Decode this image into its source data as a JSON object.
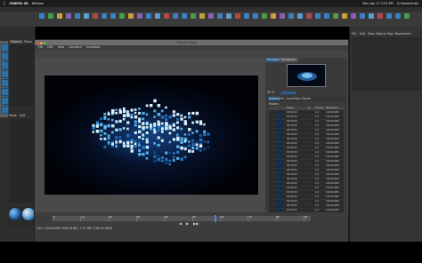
{
  "menubar": {
    "apple": "",
    "app_name": "CINEMA 4D",
    "items": [
      "Window"
    ],
    "right": "Mon Apr 17 1:53 PM",
    "user": "EJ Hassenfratz"
  },
  "picture_viewer": {
    "title": "Picture Viewer",
    "menu": [
      "File",
      "Edit",
      "View",
      "Compare",
      "Animation"
    ],
    "side_tabs": [
      "Navigator",
      "Histogram"
    ],
    "zoom": "50 %",
    "side_subtabs": [
      "History",
      "Info",
      "Layer",
      "Filter",
      "Stereo"
    ],
    "history_label": "History",
    "history_columns": [
      "Name",
      "R",
      "Frames",
      "Resolution"
    ],
    "history_rows": [
      {
        "name": "00:00:00",
        "r": "",
        "frames": "1/1",
        "res": "1920x1080"
      },
      {
        "name": "00:00:00",
        "r": "",
        "frames": "1/1",
        "res": "1920x1080"
      },
      {
        "name": "00:00:00",
        "r": "",
        "frames": "1/1",
        "res": "1920x1080"
      },
      {
        "name": "00:00:00",
        "r": "",
        "frames": "1/1",
        "res": "1920x1080"
      },
      {
        "name": "00:00:00",
        "r": "",
        "frames": "1/1",
        "res": "1920x1080"
      },
      {
        "name": "00:00:00",
        "r": "",
        "frames": "1/1",
        "res": "1920x1080"
      },
      {
        "name": "00:00:00",
        "r": "",
        "frames": "1/1",
        "res": "1920x1080"
      },
      {
        "name": "00:00:00",
        "r": "",
        "frames": "1/1",
        "res": "1920x1080"
      },
      {
        "name": "00:00:00",
        "r": "",
        "frames": "1/1",
        "res": "1920x1080"
      },
      {
        "name": "00:00:00",
        "r": "",
        "frames": "1/1",
        "res": "1920x1080"
      },
      {
        "name": "00:00:00",
        "r": "",
        "frames": "1/1",
        "res": "1920x1080"
      },
      {
        "name": "00:00:00",
        "r": "",
        "frames": "1/1",
        "res": "1920x1080"
      },
      {
        "name": "00:00:00",
        "r": "",
        "frames": "1/1",
        "res": "1920x1080"
      },
      {
        "name": "00:00:00",
        "r": "",
        "frames": "1/1",
        "res": "1920x1080"
      },
      {
        "name": "00:00:00",
        "r": "",
        "frames": "1/1",
        "res": "1920x1080"
      },
      {
        "name": "00:00:00",
        "r": "",
        "frames": "1/1",
        "res": "1920x1080"
      },
      {
        "name": "00:00:00",
        "r": "",
        "frames": "1/1",
        "res": "1920x1080"
      },
      {
        "name": "00:00:00",
        "r": "",
        "frames": "1/1",
        "res": "1920x1080"
      },
      {
        "name": "00:00:00",
        "r": "",
        "frames": "1/1",
        "res": "1920x1080"
      },
      {
        "name": "00:00:00",
        "r": "",
        "frames": "1/1",
        "res": "1920x1080"
      },
      {
        "name": "00:00:00",
        "r": "",
        "frames": "1/1",
        "res": "1920x1080"
      },
      {
        "name": "00:00:00",
        "r": "",
        "frames": "1/1",
        "res": "1920x1080"
      },
      {
        "name": "00:00:00",
        "r": "",
        "frames": "1/1",
        "res": "1920x1080"
      },
      {
        "name": "00:00:00",
        "r": "",
        "frames": "1/1",
        "res": "1920x1080"
      },
      {
        "name": "00:00:00",
        "r": "",
        "frames": "1/1",
        "res": "1920x1080"
      },
      {
        "name": "00:00:00",
        "r": "",
        "frames": "1/1",
        "res": "1920x1080"
      }
    ],
    "timeline_labels": [
      "0",
      "10",
      "20",
      "30",
      "40",
      "50",
      "60",
      "70",
      "80",
      "90"
    ],
    "playhead_frame": 58,
    "timeline_max": 90,
    "status": "Size: 1920x1080, RGB (8 Bit), 7.97 MB, 3.98 (in RAM)"
  },
  "left_panel": {
    "tabs": [
      "Objects",
      "Takes"
    ],
    "attr_tabs": [
      "Mode",
      "Edit",
      "User Data"
    ]
  },
  "right_panel": {
    "menu": [
      "File",
      "Edit",
      "View",
      "Objects",
      "Tags",
      "Bookmarks"
    ]
  },
  "colors": {
    "accent": "#2d5d8f",
    "render_glow": "#3fa8ff"
  }
}
